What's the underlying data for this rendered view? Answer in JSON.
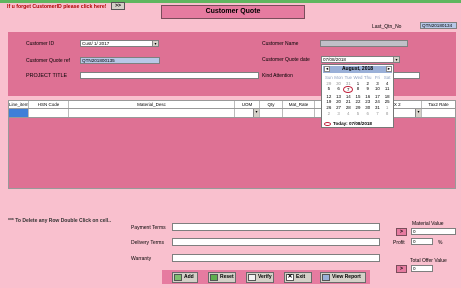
{
  "header": {
    "forget_text": "If u forget CustomerID please click here!",
    "forget_button": ">>",
    "title": "Customer Quote",
    "last_qtn_label": "Last_Qtn_No",
    "last_qtn_value": "QTN20180134"
  },
  "form": {
    "customer_id_label": "Customer ID",
    "customer_id_value": "Cust/ 1/ 2017",
    "customer_quote_ref_label": "Customer Quote ref",
    "customer_quote_ref_value": "QTN201800135",
    "project_title_label": "PROJECT TITLE",
    "project_title_value": "",
    "customer_name_label": "Customer Name",
    "customer_name_value": "",
    "customer_quote_date_label": "Customer Quote date",
    "customer_quote_date_value": "07/08/2018",
    "kind_attention_label": "Kind Attention",
    "kind_attention_value": ""
  },
  "calendar": {
    "prev": "◄",
    "next": "►",
    "month_label": "August, 2018",
    "day_names": [
      "Sun",
      "Mon",
      "Tue",
      "Wed",
      "Thu",
      "Fri",
      "Sat"
    ],
    "days": [
      [
        "29",
        "30",
        "31",
        "1",
        "2",
        "3",
        "4"
      ],
      [
        "5",
        "6",
        "7",
        "8",
        "9",
        "10",
        "11"
      ],
      [
        "12",
        "13",
        "14",
        "15",
        "16",
        "17",
        "18"
      ],
      [
        "19",
        "20",
        "21",
        "22",
        "23",
        "24",
        "25"
      ],
      [
        "26",
        "27",
        "28",
        "29",
        "30",
        "31",
        "1"
      ],
      [
        "2",
        "3",
        "4",
        "5",
        "6",
        "7",
        "8"
      ]
    ],
    "today_label": "Today: 07/08/2018"
  },
  "grid": {
    "columns": [
      "Line_item",
      "HSN Code",
      "Material_Desc",
      "UOM",
      "Qty",
      "Mat_Rate",
      "",
      "TAX 1",
      "TAX 2",
      "Tax2 Rate"
    ]
  },
  "note": "*** To Delete any Row  Double Click on cell..",
  "bottom": {
    "payment_terms_label": "Payment Terms",
    "delivery_terms_label": "Delivery Terms",
    "warranty_label": "Warranty",
    "material_value_label": "Material Value",
    "material_value": "0",
    "profit_label": "Profit",
    "profit_value": "0",
    "percent_sign": "%",
    "total_offer_label": "Total Offer Value",
    "total_offer_value": "0",
    "arrow_button": ">"
  },
  "toolbar": {
    "add": "Add",
    "reset": "Reset",
    "verify": "Verify",
    "exit": "Exit",
    "view_report": "View Report"
  }
}
